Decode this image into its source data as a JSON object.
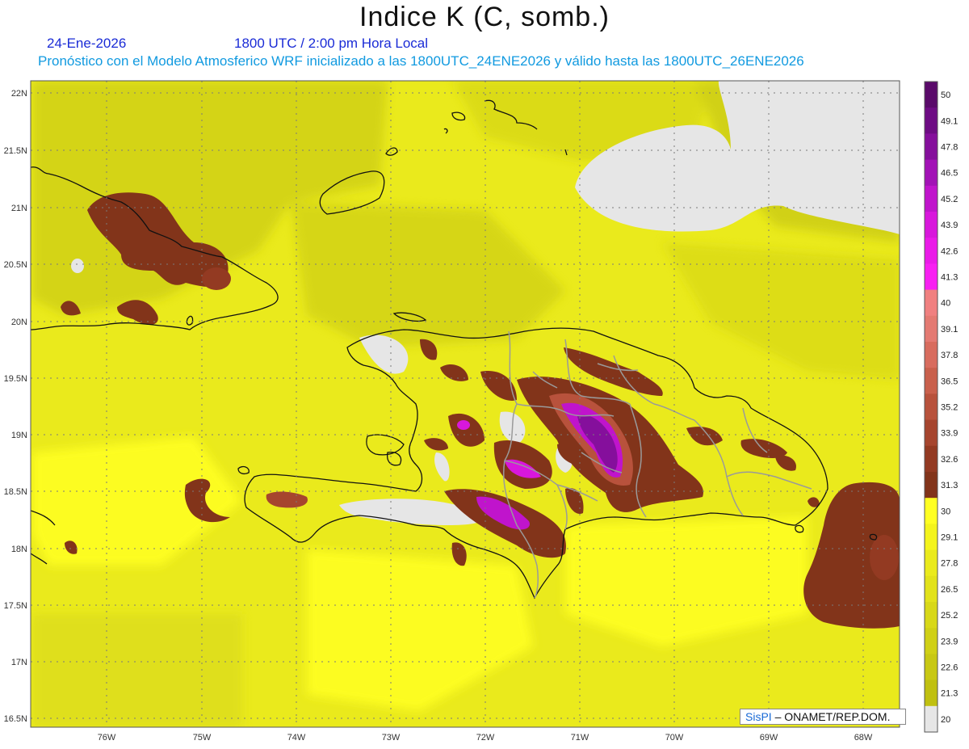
{
  "title": "Indice K (C, somb.)",
  "date": "24-Ene-2026",
  "valid_time": "1800 UTC / 2:00 pm Hora Local",
  "forecast_line": "Pronóstico con el Modelo Atmosferico WRF inicializado a las 1800UTC_24ENE2026 y válido hasta las  1800UTC_26ENE2026",
  "credit": {
    "logo": "SisPI",
    "text": " – ONAMET/REP.DOM."
  },
  "lat_labels": [
    "22N",
    "21.5N",
    "21N",
    "20.5N",
    "20N",
    "19.5N",
    "19N",
    "18.5N",
    "18N",
    "17.5N",
    "17N",
    "16.5N"
  ],
  "lon_labels": [
    "76W",
    "75W",
    "74W",
    "73W",
    "72W",
    "71W",
    "70W",
    "69W",
    "68W"
  ],
  "colorbar": [
    {
      "label": "50",
      "color": "#5a0a6a"
    },
    {
      "label": "49.1",
      "color": "#6e0c84"
    },
    {
      "label": "47.8",
      "color": "#850f9c"
    },
    {
      "label": "46.5",
      "color": "#a212b6"
    },
    {
      "label": "45.2",
      "color": "#c014cc"
    },
    {
      "label": "43.9",
      "color": "#d817dc"
    },
    {
      "label": "42.6",
      "color": "#ea1ae8"
    },
    {
      "label": "41.3",
      "color": "#f81ff2"
    },
    {
      "label": "40",
      "color": "#f08080"
    },
    {
      "label": "39.1",
      "color": "#e47a72"
    },
    {
      "label": "37.8",
      "color": "#d86c5e"
    },
    {
      "label": "36.5",
      "color": "#c9604c"
    },
    {
      "label": "35.2",
      "color": "#b8523c"
    },
    {
      "label": "33.9",
      "color": "#a6452e"
    },
    {
      "label": "32.6",
      "color": "#933a22"
    },
    {
      "label": "31.3",
      "color": "#82341a"
    },
    {
      "label": "30",
      "color": "#ffff22"
    },
    {
      "label": "29.1",
      "color": "#f4f41c"
    },
    {
      "label": "27.8",
      "color": "#eaea1c"
    },
    {
      "label": "26.5",
      "color": "#e2e21a"
    },
    {
      "label": "25.2",
      "color": "#d8d818"
    },
    {
      "label": "23.9",
      "color": "#d0d016"
    },
    {
      "label": "22.6",
      "color": "#c8c814"
    },
    {
      "label": "21.3",
      "color": "#c0c010"
    },
    {
      "label": "20",
      "color": "#e6e6e6"
    }
  ]
}
